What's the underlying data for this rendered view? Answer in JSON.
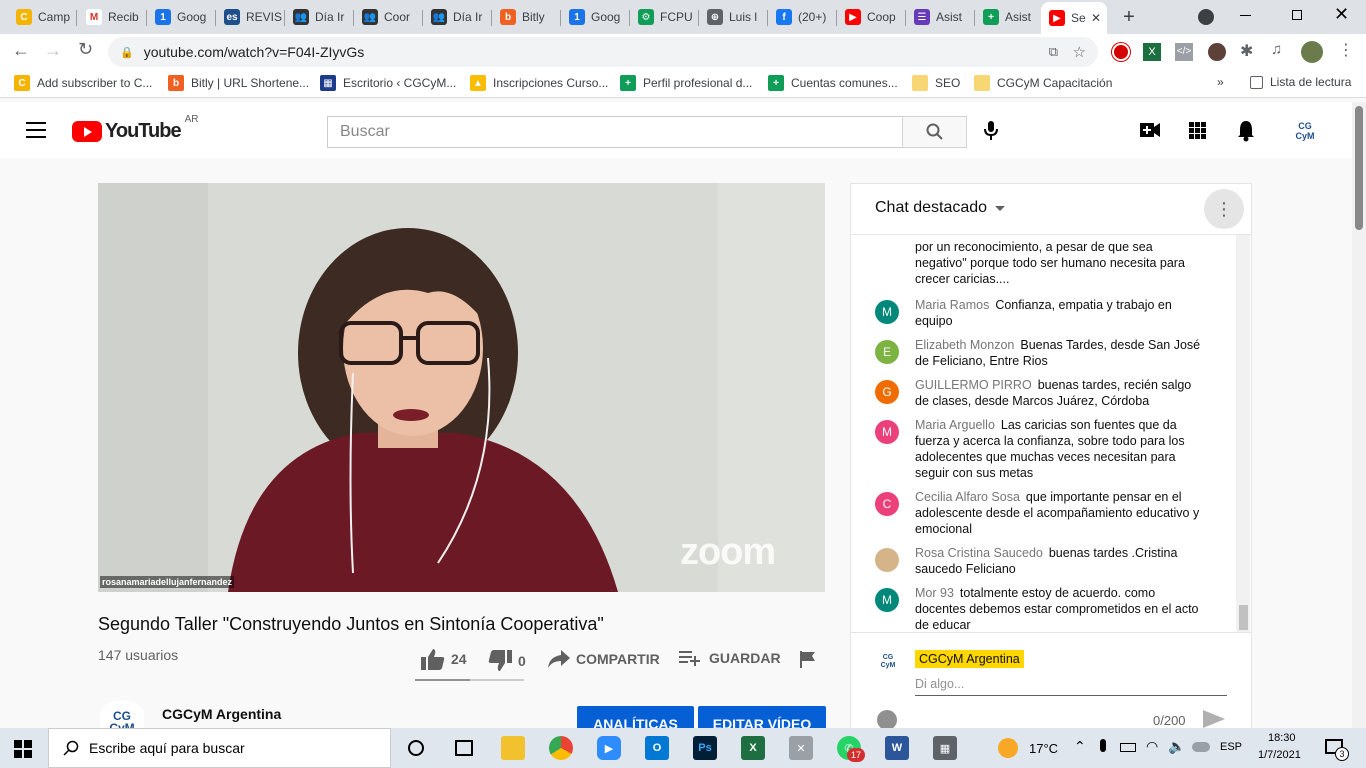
{
  "tabs": [
    {
      "label": "Camp",
      "color": "#f4b400",
      "glyph": "C"
    },
    {
      "label": "Recib",
      "color": "#ffffff",
      "glyph": "M",
      "glyph_color": "#d93025"
    },
    {
      "label": "Goog",
      "color": "#1a73e8",
      "glyph": "1"
    },
    {
      "label": "REVIS",
      "color": "#1e4e8c",
      "glyph": "es"
    },
    {
      "label": "Día Ir",
      "color": "#333333",
      "glyph": "👥"
    },
    {
      "label": "Coor",
      "color": "#333333",
      "glyph": "👥"
    },
    {
      "label": "Día Ir",
      "color": "#333333",
      "glyph": "👥"
    },
    {
      "label": "Bitly",
      "color": "#ee6123",
      "glyph": "b"
    },
    {
      "label": "Goog",
      "color": "#1a73e8",
      "glyph": "1"
    },
    {
      "label": "FCPU",
      "color": "#0f9d58",
      "glyph": "⚙"
    },
    {
      "label": "Luis l",
      "color": "#5f6368",
      "glyph": "⊕"
    },
    {
      "label": "(20+)",
      "color": "#1877f2",
      "glyph": "f"
    },
    {
      "label": "Coop",
      "color": "#ff0000",
      "glyph": "▶"
    },
    {
      "label": "Asist",
      "color": "#673ab7",
      "glyph": "☰"
    },
    {
      "label": "Asist",
      "color": "#0f9d58",
      "glyph": "+"
    },
    {
      "label": "Se",
      "color": "#ff0000",
      "glyph": "▶"
    }
  ],
  "url": "youtube.com/watch?v=F04I-ZIyvGs",
  "bookmarks": [
    {
      "label": "Add subscriber to C...",
      "color": "#f4b400",
      "glyph": "C"
    },
    {
      "label": "Bitly | URL Shortene...",
      "color": "#ee6123",
      "glyph": "b"
    },
    {
      "label": "Escritorio ‹ CGCyM...",
      "color": "#1e3a8a",
      "glyph": "▦"
    },
    {
      "label": "Inscripciones Curso...",
      "color": "#fbbc04",
      "glyph": "▲"
    },
    {
      "label": "Perfil profesional d...",
      "color": "#0f9d58",
      "glyph": "+"
    },
    {
      "label": "Cuentas comunes...",
      "color": "#0f9d58",
      "glyph": "+"
    },
    {
      "label": "SEO",
      "color": "#f7d774",
      "glyph": ""
    },
    {
      "label": "CGCyM Capacitación",
      "color": "#f7d774",
      "glyph": ""
    }
  ],
  "bookmarks_more": "»",
  "reading_list": "Lista de lectura",
  "youtube": {
    "logo_text": "YouTube",
    "country": "AR",
    "search_placeholder": "Buscar",
    "channel_avatar_text": "CG\nCyM"
  },
  "video": {
    "participant_name": "rosanamariadellujanfernandez",
    "watermark": "zoom",
    "title": "Segundo Taller \"Construyendo Juntos en Sintonía Cooperativa\"",
    "viewers": "147 usuarios",
    "likes": "24",
    "dislikes": "0",
    "like_ratio": 1.0,
    "share_label": "COMPARTIR",
    "save_label": "GUARDAR",
    "channel_name": "CGCyM Argentina",
    "analytics_label": "ANALÍTICAS",
    "edit_label": "EDITAR VÍDEO"
  },
  "chat": {
    "header": "Chat destacado",
    "messages": [
      {
        "author": "",
        "text": "por un reconocimiento, a pesar de que sea negativo\" porque todo ser humano necesita para crecer caricias....",
        "initial": "",
        "color": ""
      },
      {
        "author": "Maria Ramos",
        "text": "Confianza, empatia y trabajo en equipo",
        "initial": "M",
        "color": "#00897b"
      },
      {
        "author": "Elizabeth Monzon",
        "text": "Buenas Tardes, desde San José de Feliciano, Entre Rios",
        "initial": "E",
        "color": "#7cb342"
      },
      {
        "author": "GUILLERMO PIRRO",
        "text": "buenas tardes, recién salgo de clases, desde Marcos Juárez, Córdoba",
        "initial": "G",
        "color": "#ef6c00"
      },
      {
        "author": "Maria Arguello",
        "text": "Las caricias son fuentes que da fuerza y acerca la confianza, sobre todo para los adolecentes que muchas veces necesitan para seguir con sus metas",
        "initial": "M",
        "color": "#ec407a"
      },
      {
        "author": "Cecilia Alfaro Sosa",
        "text": "que importante pensar en el adolescente desde el acompañamiento educativo y emocional",
        "initial": "C",
        "color": "#ec407a"
      },
      {
        "author": "Rosa Cristina Saucedo",
        "text": "buenas tardes .Cristina saucedo Feliciano",
        "initial": "",
        "color": "#d6b48a"
      },
      {
        "author": "Mor 93",
        "text": "totalmente estoy de acuerdo. como docentes debemos estar comprometidos en el acto de educar",
        "initial": "M",
        "color": "#00897b"
      }
    ],
    "self_author": "CGCyM Argentina",
    "input_placeholder": "Di algo...",
    "char_count": "0/200"
  },
  "taskbar": {
    "search_placeholder": "Escribe aquí para buscar",
    "weather": "17°C",
    "lang": "ESP",
    "time": "18:30",
    "date": "1/7/2021",
    "notifications": "3",
    "whatsapp_badge": "17"
  }
}
